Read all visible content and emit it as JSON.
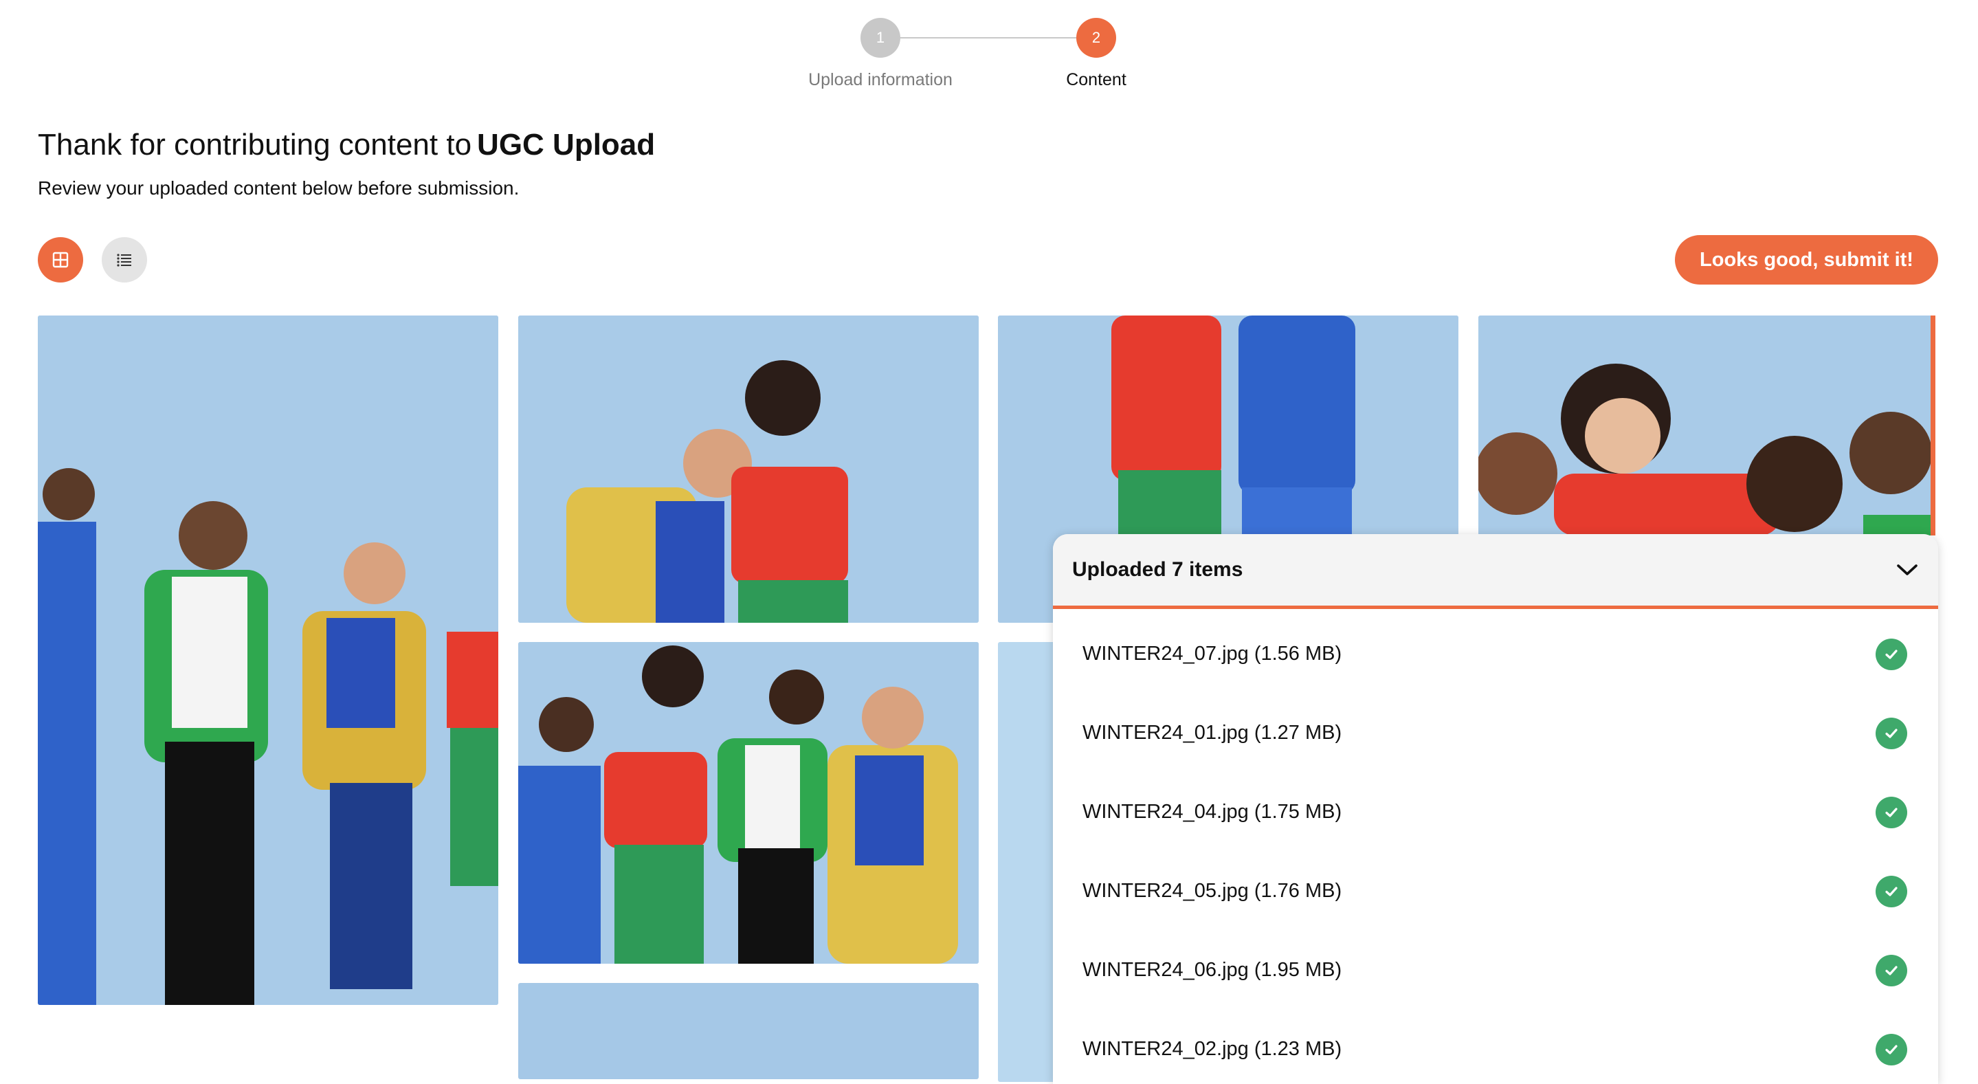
{
  "stepper": {
    "steps": [
      {
        "number": "1",
        "label": "Upload information"
      },
      {
        "number": "2",
        "label": "Content"
      }
    ]
  },
  "header": {
    "title_prefix": "Thank for contributing content to",
    "title_brand": "UGC Upload",
    "subtitle": "Review your uploaded content below before submission."
  },
  "toolbar": {
    "grid_icon": "grid-view-icon",
    "list_icon": "list-view-icon",
    "submit_label": "Looks good, submit it!"
  },
  "colors": {
    "accent": "#ed6b40",
    "success": "#3fa96b",
    "inactive_step": "#c8c8c8"
  },
  "upload_panel": {
    "title": "Uploaded 7 items",
    "toggle_icon": "chevron-down-icon",
    "files": [
      {
        "name": "WINTER24_07.jpg (1.56 MB)",
        "status_icon": "check-circle-icon"
      },
      {
        "name": "WINTER24_01.jpg (1.27 MB)",
        "status_icon": "check-circle-icon"
      },
      {
        "name": "WINTER24_04.jpg (1.75 MB)",
        "status_icon": "check-circle-icon"
      },
      {
        "name": "WINTER24_05.jpg (1.76 MB)",
        "status_icon": "check-circle-icon"
      },
      {
        "name": "WINTER24_06.jpg (1.95 MB)",
        "status_icon": "check-circle-icon"
      },
      {
        "name": "WINTER24_02.jpg (1.23 MB)",
        "status_icon": "check-circle-icon"
      }
    ]
  }
}
